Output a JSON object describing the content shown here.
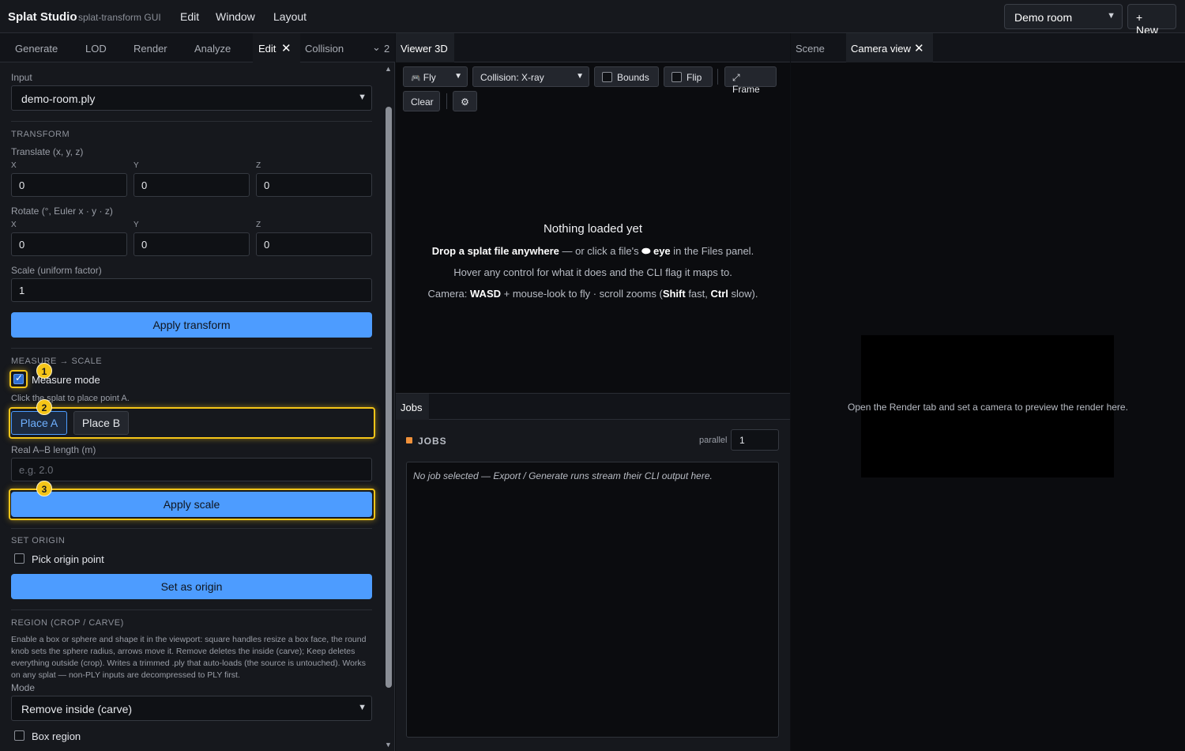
{
  "topbar": {
    "brand": "Splat Studio",
    "brand_sub": "splat-transform GUI",
    "menus": [
      "Edit",
      "Window",
      "Layout"
    ],
    "room_select": "Demo room",
    "new_button": "+ New"
  },
  "left_tabs": {
    "items": [
      "Generate",
      "LOD",
      "Render",
      "Analyze",
      "Edit",
      "Collision"
    ],
    "active": "Edit",
    "overflow_count": "2"
  },
  "edit": {
    "input_label": "Input",
    "input_file": "demo-room.ply",
    "transform": {
      "heading": "TRANSFORM",
      "translate_label": "Translate (x, y, z)",
      "rotate_label": "Rotate (°, Euler x · y · z)",
      "axis_x": "X",
      "axis_y": "Y",
      "axis_z": "Z",
      "translate": [
        "0",
        "0",
        "0"
      ],
      "rotate": [
        "0",
        "0",
        "0"
      ],
      "scale_label": "Scale (uniform factor)",
      "scale_value": "1",
      "apply_button": "Apply transform"
    },
    "measure": {
      "heading": "MEASURE → SCALE",
      "mode_label": "Measure mode",
      "mode_checked": true,
      "hint": "Click the splat to place point A.",
      "place_a": "Place A",
      "place_b": "Place B",
      "length_label": "Real A–B length (m)",
      "length_placeholder": "e.g. 2.0",
      "apply_button": "Apply scale",
      "badges": [
        "1",
        "2",
        "3"
      ]
    },
    "origin": {
      "heading": "SET ORIGIN",
      "pick_label": "Pick origin point",
      "set_button": "Set as origin"
    },
    "region": {
      "heading": "REGION (CROP / CARVE)",
      "description": "Enable a box or sphere and shape it in the viewport: square handles resize a box face, the round knob sets the sphere radius, arrows move it. Remove deletes the inside (carve); Keep deletes everything outside (crop). Writes a trimmed .ply that auto-loads (the source is untouched). Works on any splat — non-PLY inputs are decompressed to PLY first.",
      "mode_label": "Mode",
      "mode_value": "Remove inside (carve)",
      "box_label": "Box region"
    }
  },
  "viewer": {
    "tab": "Viewer 3D",
    "fly_mode": "Fly",
    "collision_mode": "Collision: X-ray",
    "bounds_label": "Bounds",
    "flip_label": "Flip",
    "frame_button": "⤢ Frame",
    "clear_button": "Clear",
    "settings_icon": "⚙",
    "empty_title": "Nothing loaded yet",
    "line1_bold": "Drop a splat file anywhere",
    "line1_rest": " — or click a file's ",
    "line1_eye": "⬬",
    "line1_eye_bold": " eye",
    "line1_end": " in the Files panel.",
    "line2": "Hover any control for what it does and the CLI flag it maps to.",
    "line3_a": "Camera: ",
    "line3_b": "WASD",
    "line3_c": " + mouse-look to fly · scroll zooms (",
    "line3_d": "Shift",
    "line3_e": " fast, ",
    "line3_f": "Ctrl",
    "line3_g": " slow)."
  },
  "jobs": {
    "tab": "Jobs",
    "heading": "JOBS",
    "parallel_label": "parallel",
    "parallel_value": "1",
    "output": "No job selected — Export / Generate runs stream their CLI output here."
  },
  "right": {
    "tabs": [
      "Scene",
      "Camera view"
    ],
    "active": "Camera view",
    "preview_message": "Open the Render tab and set a camera to preview the render here."
  },
  "colors": {
    "accent": "#4d9cff",
    "highlight": "#f5c518",
    "jobs_dot": "#f0913a"
  }
}
